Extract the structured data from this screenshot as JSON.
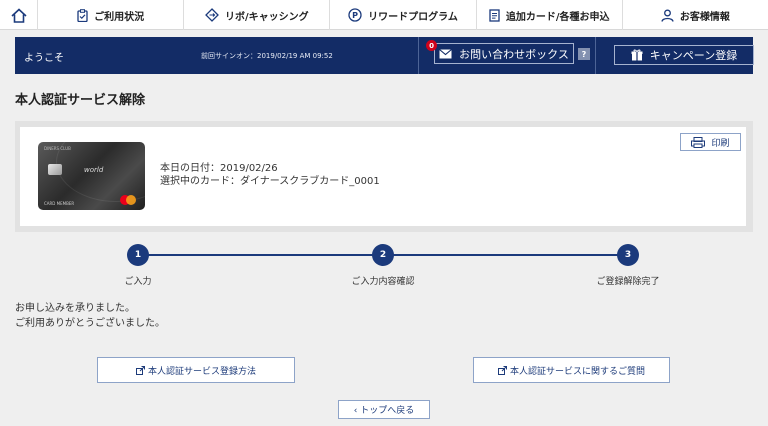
{
  "topnav": {
    "items": [
      {
        "label": "ご利用状況",
        "icon": "clipboard-icon"
      },
      {
        "label": "リボ/キャッシング",
        "icon": "diamond-arrows-icon"
      },
      {
        "label": "リワードプログラム",
        "icon": "p-circle-icon"
      },
      {
        "label": "追加カード/各種お申込",
        "icon": "document-icon"
      },
      {
        "label": "お客様情報",
        "icon": "user-icon"
      }
    ]
  },
  "header": {
    "welcome": "ようこそ",
    "last_signin": "前回サインオン：2019/02/19 AM 09:52",
    "inquiry_label": "お問い合わせボックス",
    "inquiry_badge": "0",
    "help": "?",
    "campaign_label": "キャンペーン登録"
  },
  "page_title": "本人認証サービス解除",
  "card_panel": {
    "date_line": "本日の日付：2019/02/26",
    "card_line": "選択中のカード：ダイナースクラブカード_0001",
    "print_label": "印刷",
    "card_brand_text": "DINERS CLUB",
    "card_world_text": "world",
    "card_member_text": "CARD MEMBER"
  },
  "steps": [
    {
      "number": "1",
      "label": "ご入力"
    },
    {
      "number": "2",
      "label": "ご入力内容確認"
    },
    {
      "number": "3",
      "label": "ご登録解除完了"
    }
  ],
  "message": {
    "line1": "お申し込みを承りました。",
    "line2": "ご利用ありがとうございました。"
  },
  "buttons": {
    "how_to_register": "本人認証サービス登録方法",
    "faq": "本人認証サービスに関するご質問",
    "back_to_top": "‹ トップへ戻る"
  },
  "colors": {
    "navy": "#132c66",
    "step": "#1b3a7c",
    "badge": "#d0021b"
  }
}
